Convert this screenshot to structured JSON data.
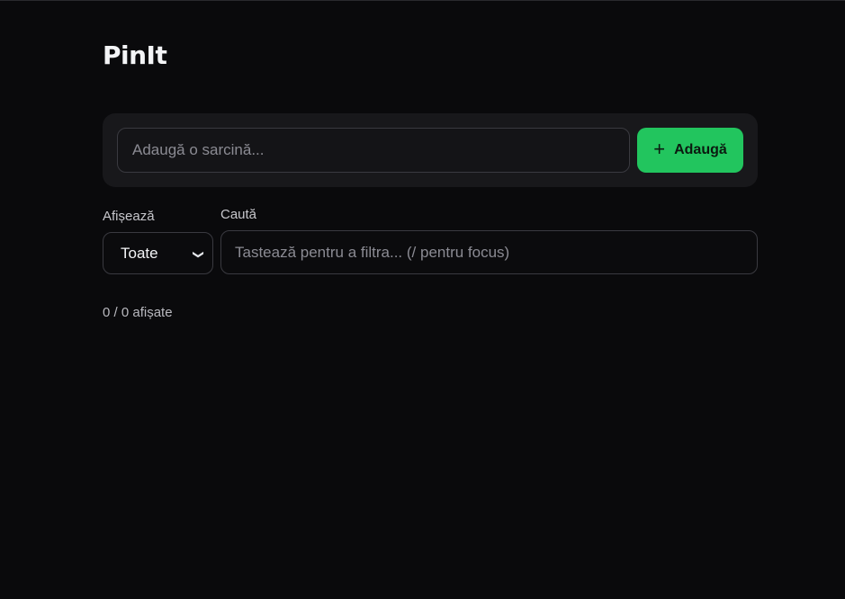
{
  "app": {
    "title": "PinIt"
  },
  "add_task": {
    "placeholder": "Adaugă o sarcină...",
    "value": "",
    "button_label": "Adaugă",
    "button_icon": "plus-icon",
    "accent_color": "#22c55e"
  },
  "filter": {
    "label": "Afișează",
    "selected": "Toate",
    "icon": "chevron-down-icon"
  },
  "search": {
    "label": "Caută",
    "placeholder": "Tastează pentru a filtra... (/ pentru focus)",
    "value": ""
  },
  "status": {
    "count_text": "0 / 0 afișate"
  }
}
